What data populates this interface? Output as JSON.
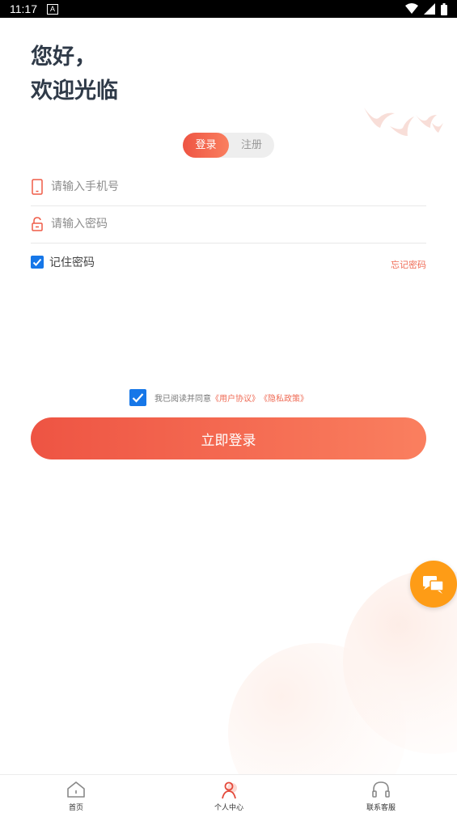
{
  "status_bar": {
    "time": "11:17",
    "notification_icon_text": "A"
  },
  "greeting": {
    "line1": "您好，",
    "line2": "欢迎光临"
  },
  "auth_tabs": {
    "login": "登录",
    "register": "注册",
    "active": "login"
  },
  "form": {
    "phone_placeholder": "请输入手机号",
    "phone_value": "",
    "password_placeholder": "请输入密码",
    "password_value": "",
    "remember_label": "记住密码",
    "remember_checked": true,
    "forgot_link": "忘记密码"
  },
  "agreement": {
    "checked": true,
    "prefix": "我已阅读并同意",
    "user_agreement": "《用户协议》",
    "privacy_policy": "《隐私政策》"
  },
  "login_button": "立即登录",
  "bottom_nav": {
    "items": [
      {
        "label": "首页",
        "icon": "home-icon"
      },
      {
        "label": "个人中心",
        "icon": "user-icon"
      },
      {
        "label": "联系客服",
        "icon": "headset-icon"
      }
    ],
    "active_index": 1
  },
  "colors": {
    "accent_start": "#ee5443",
    "accent_end": "#fa7f5f",
    "checkbox_blue": "#1677e8",
    "fab_orange": "#fe9c16",
    "title_text": "#2f3a48"
  }
}
